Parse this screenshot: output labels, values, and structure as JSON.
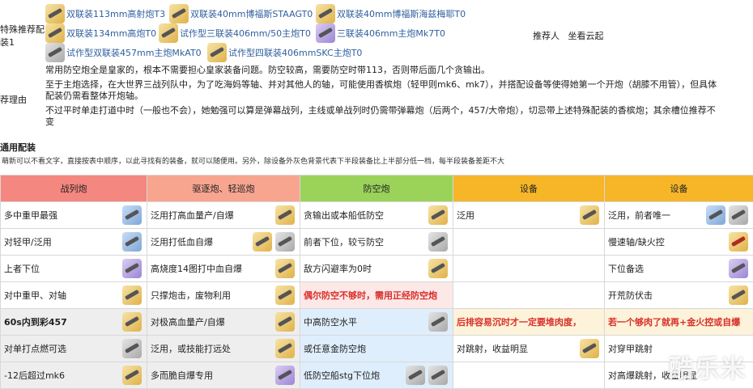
{
  "special": {
    "label_line1": "特殊推荐配",
    "label_line2": "装1",
    "items": [
      {
        "text": "双联装113mm高射炮T3",
        "icon": "gun-icon"
      },
      {
        "text": "双联装40mm博福斯STAAGT0",
        "icon": "gun-icon"
      },
      {
        "text": "双联装40mm博福斯海兹梅耶T0",
        "icon": "gun-icon"
      },
      {
        "text": "双联装134mm高炮T0",
        "icon": "gun-icon"
      },
      {
        "text": "试作型三联装406mm/50主炮T0",
        "icon": "gun-icon"
      },
      {
        "text": "三联装406mm主炮Mk7T0",
        "icon": "gun-icon"
      },
      {
        "text": "试作型双联装457mm主炮MkAT0",
        "icon": "gun-icon"
      },
      {
        "text": "试作型四联装406mmSKC主炮T0",
        "icon": "gun-icon"
      }
    ],
    "recommender_label": "推荐人",
    "recommender_name": "坐看云起"
  },
  "reason": {
    "label": "荐理由",
    "lines": [
      "常用防空炮全是皇家的，根本不需要担心皇家装备问题。防空较高，需要防空时带113，否则带后面几个贪输出。",
      "至于主炮选择，在大世界三战列队中，为了吃海妈等轴、并对其他人的轴，可能使用香槟炮（轻甲则mk6、mk7），并搭配设备等使得她第一个开炮（胡膝不用管），但具体",
      "配装仍需看整体开炮轴。",
      "不过平时单走打道中时（一般也不会），她勉强可以算是弹幕战列，主线或单战列时仍需带弹幕炮（后两个，457/大帝炮），切忌带上述特殊配装的香槟炮；其余槽位推荐不",
      "变"
    ]
  },
  "general": {
    "title": "通用配装",
    "note": "萌新可以不看文字，直接按表中顺序，以此寻找有的装备，就可以随便用。另外，除设备外灰色背景代表下半段装备比上半部分低一档，每半段装备差距不大"
  },
  "table": {
    "headers": [
      "战列炮",
      "驱逐炮、轻巡炮",
      "防空炮",
      "设备",
      "设备"
    ],
    "header_colors": [
      "#f4877f",
      "#f7a58f",
      "#9bd25a",
      "#f6b628",
      "#f6b628"
    ],
    "rows": [
      [
        "多中重甲最强",
        "泛用打高血量产/自爆",
        "贪输出或本船低防空",
        "泛用",
        "泛用，前者唯一"
      ],
      [
        "对轻甲/泛用",
        "泛用打低血自爆",
        "前者下位，较亏防空",
        "",
        "慢速轴/缺火控"
      ],
      [
        "上者下位",
        "高烧度14图打中血自爆",
        "敌方闪避率为0时",
        "",
        "下位备选"
      ],
      [
        "对中重甲、对轴",
        "只撑炮击，废物利用",
        "偶尔防空不够时，需用正经防空炮",
        "",
        "开荒防伏击"
      ],
      [
        "60s内到彩457",
        "对极高血量产/自爆",
        "中高防空水平",
        "后排容易沉时才一定要堆肉度，",
        "若一个够肉了就再+金火控或自爆"
      ],
      [
        "对单打点燃可选",
        "泛用，或技能打远处",
        "或任意金防空炮",
        "对跳射，收益明显",
        "对穿甲跳射"
      ],
      [
        "-12后超过mk6",
        "多而脆自爆专用",
        "低防空船stg下位炮",
        "",
        "对高爆跳射，收益明显"
      ]
    ]
  },
  "watermark": "酷乐米"
}
